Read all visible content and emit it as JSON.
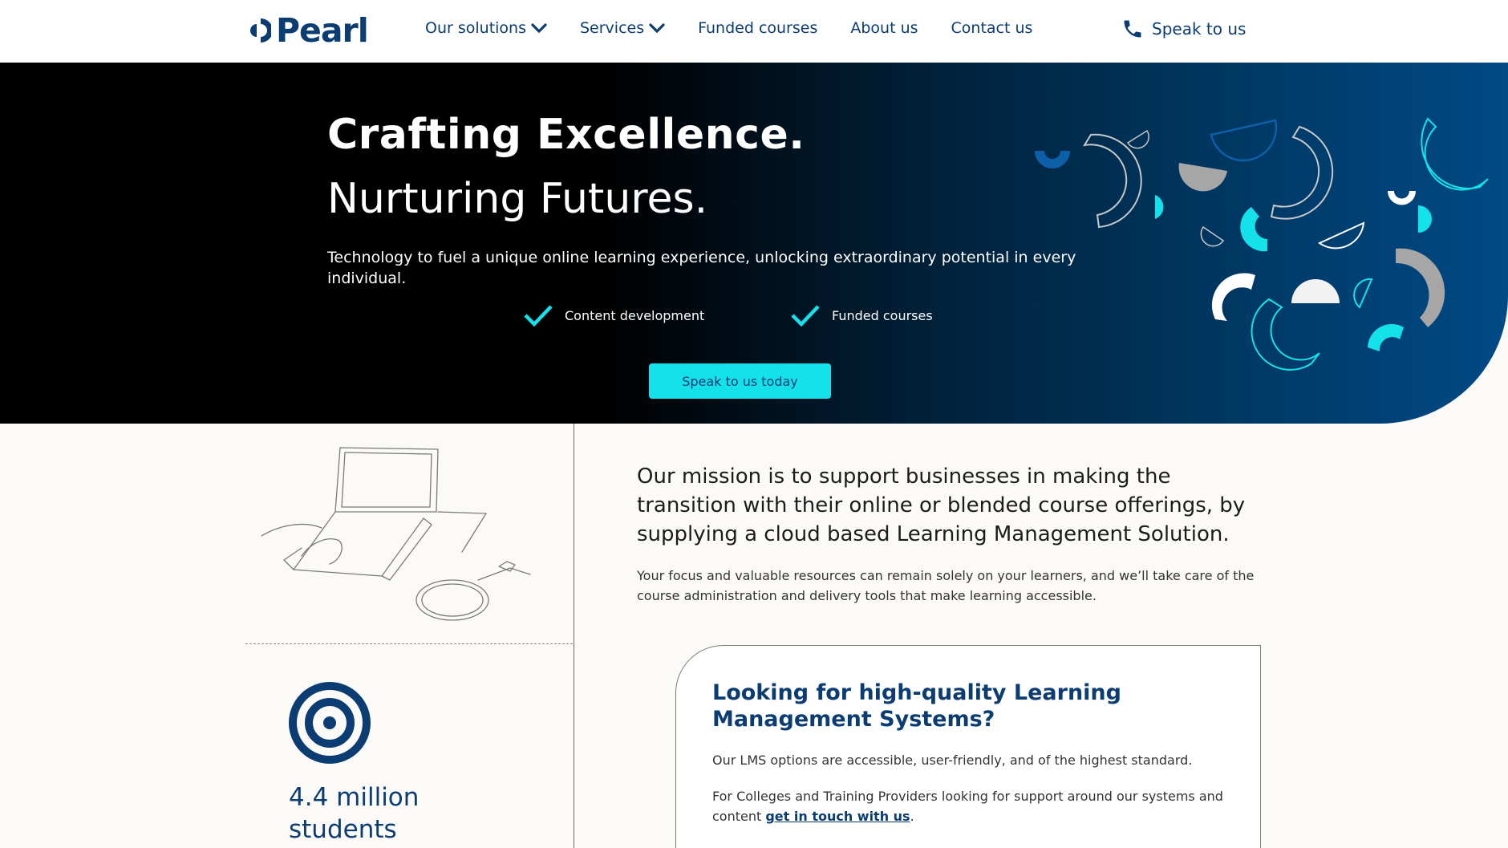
{
  "nav": {
    "logo_text": "Pearl",
    "items": [
      {
        "label": "Our solutions"
      },
      {
        "label": "Services"
      },
      {
        "label": "Funded courses"
      },
      {
        "label": "About us"
      },
      {
        "label": "Contact us"
      }
    ],
    "speak_label": "Speak to us"
  },
  "hero": {
    "title": "Crafting Excellence.",
    "subtitle": "Nurturing Futures.",
    "text": "Technology to fuel a unique online learning experience, unlocking extraordinary potential in every individual.",
    "features": [
      "Content development",
      "Funded courses"
    ],
    "cta_label": "Speak to us today"
  },
  "stats": {
    "value": "4.4 million",
    "label": "students"
  },
  "mission": {
    "heading": "Our mission is to support businesses in making the transition with their online or blended course offerings, by supplying a cloud based Learning Management Solution.",
    "text": "Your focus and valuable resources can remain solely on your learners, and we’ll take care of the course administration and delivery tools that make learning accessible."
  },
  "card": {
    "title": "Looking for high-quality Learning Management Systems?",
    "p1": "Our LMS options are accessible, user-friendly, and of the highest standard.",
    "p2_before": "For Colleges and Training Providers looking for support around our systems and content ",
    "p2_link": "get in touch with us",
    "p2_after": "."
  },
  "colors": {
    "brand": "#0b3d73",
    "accent": "#14e2ea",
    "background": "#fbfaf6"
  },
  "icons": [
    "logo-mark-icon",
    "chevron-down-icon",
    "phone-icon",
    "check-icon",
    "target-icon"
  ]
}
